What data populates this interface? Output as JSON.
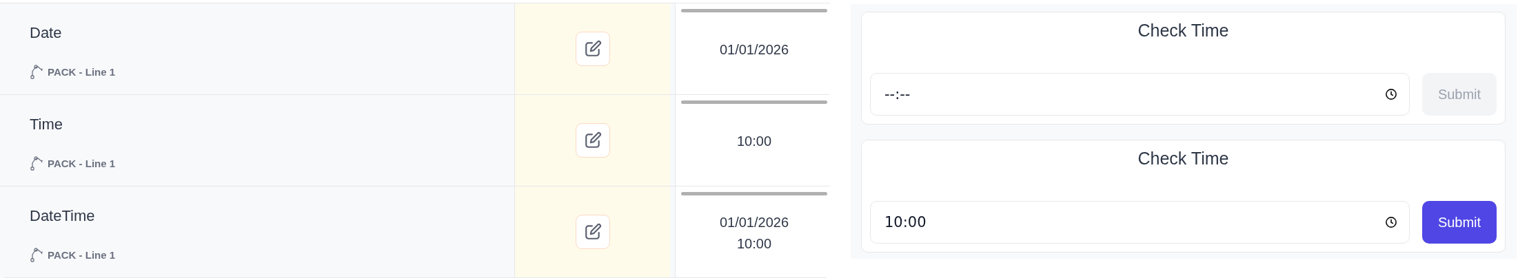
{
  "rows": [
    {
      "title": "Date",
      "location": "PACK - Line 1",
      "value_lines": [
        "01/01/2026"
      ]
    },
    {
      "title": "Time",
      "location": "PACK - Line 1",
      "value_lines": [
        "10:00"
      ]
    },
    {
      "title": "DateTime",
      "location": "PACK - Line 1",
      "value_lines": [
        "01/01/2026",
        "10:00"
      ]
    }
  ],
  "cards": [
    {
      "title": "Check Time",
      "field": {
        "placeholder": "--:--"
      },
      "button": {
        "label": "Submit",
        "disabled": true
      }
    },
    {
      "title": "Check Time",
      "field": {
        "value": "10:00"
      },
      "button": {
        "label": "Submit",
        "disabled": false
      }
    }
  ]
}
